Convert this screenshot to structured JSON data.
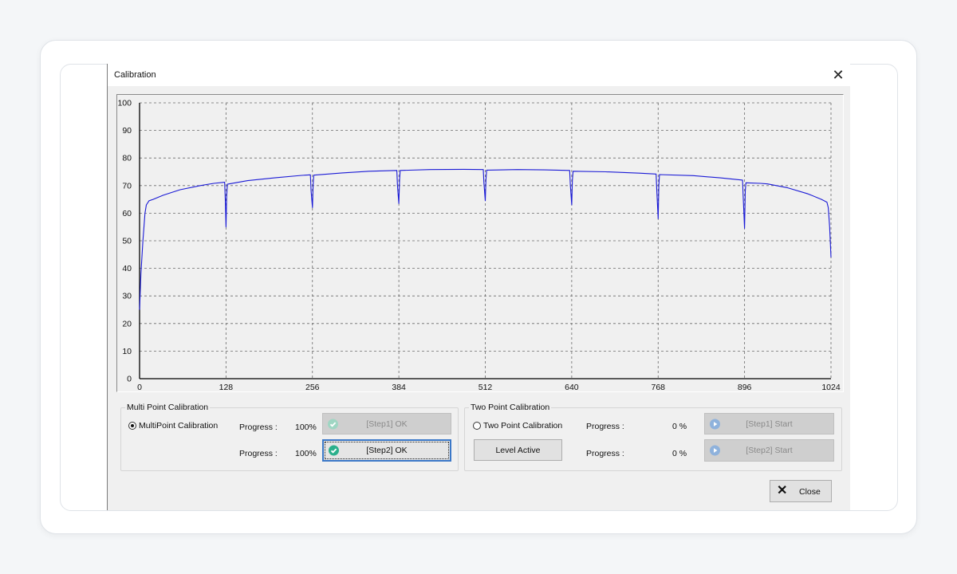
{
  "window": {
    "title": "Calibration"
  },
  "chart_data": {
    "type": "line",
    "title": "",
    "xlabel": "",
    "ylabel": "",
    "xlim": [
      0,
      1024
    ],
    "ylim": [
      0,
      100
    ],
    "grid": true,
    "x_ticks": [
      0,
      128,
      256,
      384,
      512,
      640,
      768,
      896,
      1024
    ],
    "y_ticks": [
      0,
      10,
      20,
      30,
      40,
      50,
      60,
      70,
      80,
      90,
      100
    ],
    "x_tick_labels": [
      "0",
      "128",
      "256",
      "384",
      "512",
      "640",
      "768",
      "896",
      "1024"
    ],
    "y_tick_labels": [
      "0",
      "10",
      "20",
      "30",
      "40",
      "50",
      "60",
      "70",
      "80",
      "90",
      "100"
    ],
    "series": [
      {
        "color": "#1a1ad6",
        "points": [
          [
            0,
            25
          ],
          [
            2,
            38
          ],
          [
            5,
            50
          ],
          [
            8,
            60
          ],
          [
            10,
            63
          ],
          [
            14,
            64.5
          ],
          [
            20,
            65
          ],
          [
            35,
            66.5
          ],
          [
            60,
            68.5
          ],
          [
            90,
            70
          ],
          [
            110,
            70.8
          ],
          [
            126,
            71.2
          ],
          [
            127,
            65
          ],
          [
            128,
            55
          ],
          [
            129,
            66
          ],
          [
            130,
            70.5
          ],
          [
            160,
            71.8
          ],
          [
            200,
            72.8
          ],
          [
            240,
            73.7
          ],
          [
            253,
            73.9
          ],
          [
            254,
            68
          ],
          [
            256,
            62
          ],
          [
            257,
            70
          ],
          [
            258,
            73.8
          ],
          [
            300,
            74.6
          ],
          [
            340,
            75.2
          ],
          [
            381,
            75.5
          ],
          [
            382,
            70
          ],
          [
            384,
            63.5
          ],
          [
            385,
            72
          ],
          [
            386,
            75.5
          ],
          [
            430,
            75.8
          ],
          [
            480,
            75.9
          ],
          [
            509,
            75.8
          ],
          [
            510,
            71
          ],
          [
            512,
            64.5
          ],
          [
            513,
            72
          ],
          [
            514,
            75.6
          ],
          [
            560,
            75.8
          ],
          [
            600,
            75.7
          ],
          [
            637,
            75.5
          ],
          [
            638,
            70
          ],
          [
            640,
            63
          ],
          [
            641,
            72
          ],
          [
            642,
            75.2
          ],
          [
            690,
            75.0
          ],
          [
            740,
            74.5
          ],
          [
            765,
            74.2
          ],
          [
            766,
            68
          ],
          [
            768,
            58
          ],
          [
            769,
            70
          ],
          [
            770,
            74
          ],
          [
            820,
            73.6
          ],
          [
            860,
            72.8
          ],
          [
            893,
            72
          ],
          [
            894,
            66
          ],
          [
            896,
            54.5
          ],
          [
            897,
            68
          ],
          [
            898,
            71
          ],
          [
            920,
            70.8
          ],
          [
            930,
            70.6
          ],
          [
            960,
            69.2
          ],
          [
            990,
            67
          ],
          [
            1010,
            65
          ],
          [
            1018,
            64
          ],
          [
            1020,
            62
          ],
          [
            1022,
            55
          ],
          [
            1024,
            44
          ]
        ]
      }
    ]
  },
  "multi_point": {
    "group_title": "Multi Point Calibration",
    "radio_label": "MultiPoint Calibration",
    "radio_selected": true,
    "step1": {
      "progress_label": "Progress :",
      "progress_value": "100%",
      "button_label": "[Step1] OK",
      "enabled": false
    },
    "step2": {
      "progress_label": "Progress :",
      "progress_value": "100%",
      "button_label": "[Step2] OK",
      "enabled": true
    }
  },
  "two_point": {
    "group_title": "Two Point Calibration",
    "radio_label": "Two Point Calibration",
    "radio_selected": false,
    "level_button": "Level Active",
    "step1": {
      "progress_label": "Progress :",
      "progress_value": "0 %",
      "button_label": "[Step1] Start",
      "enabled": false
    },
    "step2": {
      "progress_label": "Progress :",
      "progress_value": "0 %",
      "button_label": "[Step2] Start",
      "enabled": false
    }
  },
  "footer": {
    "close_label": "Close"
  },
  "colors": {
    "series": "#1a1ad6",
    "focus": "#3b78c8",
    "ok_icon": "#2bb08c"
  }
}
